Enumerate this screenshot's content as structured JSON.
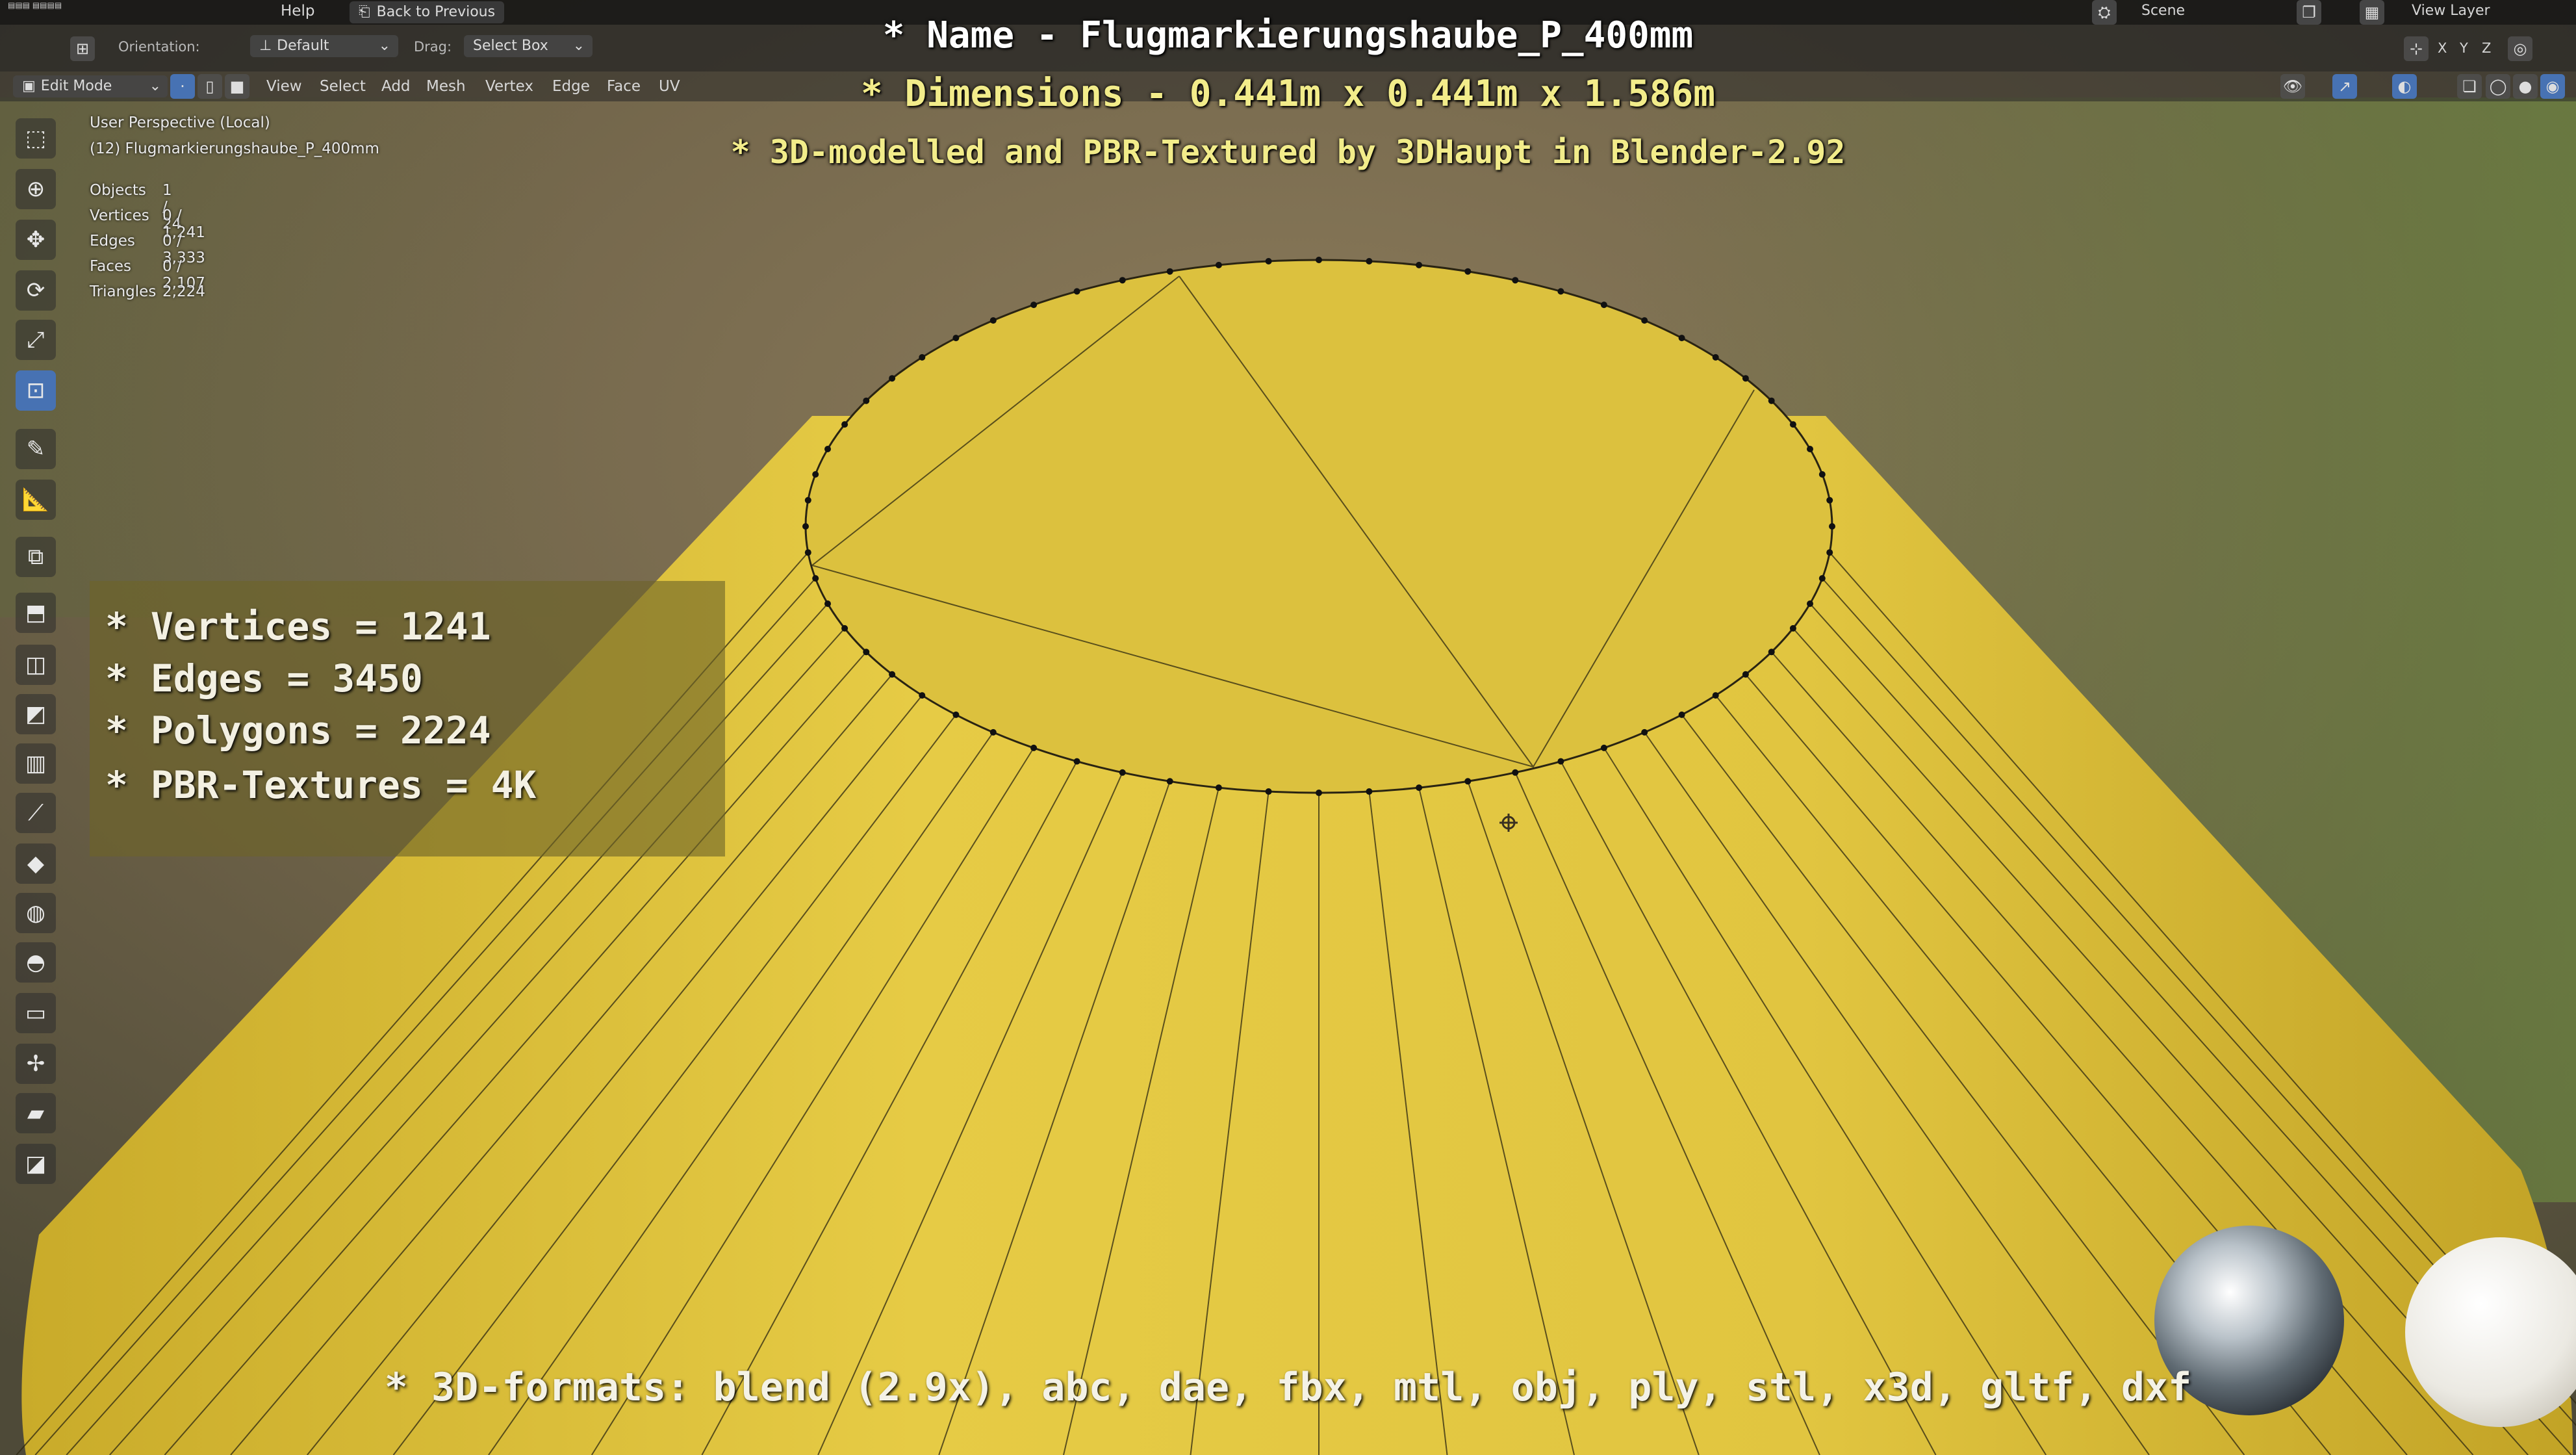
{
  "topbar": {
    "help_menu": "Help",
    "back_button": "Back to Previous",
    "scene_label": "Scene",
    "view_layer_label": "View Layer"
  },
  "header": {
    "orientation_label": "Orientation:",
    "orientation_value": "Default",
    "drag_label": "Drag:",
    "drag_value": "Select Box"
  },
  "modebar": {
    "mode": "Edit Mode",
    "menus": [
      "View",
      "Select",
      "Add",
      "Mesh",
      "Vertex",
      "Edge",
      "Face",
      "UV"
    ]
  },
  "viewport": {
    "perspective": "User Perspective (Local)",
    "object_name": "(12) Flugmarkierungshaube_P_400mm",
    "stats": [
      {
        "label": "Objects",
        "value": "1 / 24"
      },
      {
        "label": "Vertices",
        "value": "0 / 1,241"
      },
      {
        "label": "Edges",
        "value": "0 / 3,333"
      },
      {
        "label": "Faces",
        "value": "0 / 2,107"
      },
      {
        "label": "Triangles",
        "value": "2,224"
      }
    ]
  },
  "overlay": {
    "title_line1": "* Name - Flugmarkierungshaube_P_400mm",
    "title_line2": "* Dimensions -  0.441m x 0.441m x 1.586m",
    "title_line3": "* 3D-modelled and PBR-Textured by 3DHaupt in Blender-2.92",
    "info": [
      "* Vertices = 1241",
      "* Edges = 3450",
      "* Polygons = 2224",
      "* PBR-Textures = 4K"
    ],
    "formats": "* 3D-formats: blend (2.9x), abc, dae, fbx, mtl, obj, ply, stl, x3d, gltf, dxf"
  },
  "colors": {
    "mesh_yellow": "#e3c63a",
    "title_white": "#ffffff",
    "title_yellow": "#f2ec8a",
    "active_tool": "#4772b3"
  },
  "icons": [
    "select-box-icon",
    "cursor-icon",
    "move-icon",
    "rotate-icon",
    "scale-icon",
    "transform-icon",
    "annotate-icon",
    "measure-icon",
    "add-cube-icon",
    "extrude-icon",
    "inset-icon",
    "bevel-icon",
    "loop-cut-icon",
    "knife-icon",
    "poly-build-icon",
    "spin-icon",
    "smooth-icon",
    "edge-slide-icon",
    "shrink-fatten-icon",
    "shear-icon",
    "rip-icon"
  ]
}
